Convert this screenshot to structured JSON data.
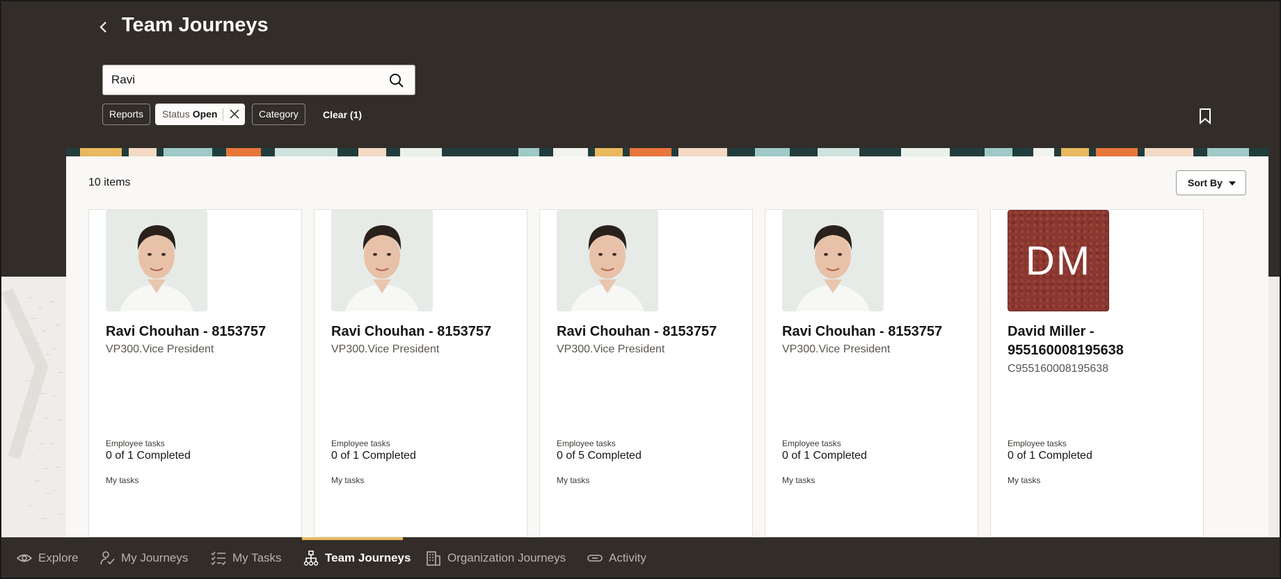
{
  "header": {
    "title": "Team Journeys",
    "back_icon": "chevron-left-icon"
  },
  "search": {
    "value": "Ravi",
    "icon": "search-icon"
  },
  "filters": {
    "reports_label": "Reports",
    "status_label": "Status",
    "status_value": "Open",
    "category_label": "Category",
    "clear_label": "Clear (1)"
  },
  "list": {
    "count_label": "10 items",
    "sort_label": "Sort By",
    "cards": [
      {
        "name": "Ravi Chouhan - 8153757",
        "subtitle": "VP300.Vice President",
        "tasks_label": "Employee tasks",
        "tasks_value": "0 of 1 Completed",
        "my_tasks_label": "My tasks"
      },
      {
        "name": "Ravi Chouhan - 8153757",
        "subtitle": "VP300.Vice President",
        "tasks_label": "Employee tasks",
        "tasks_value": "0 of 1 Completed",
        "my_tasks_label": "My tasks"
      },
      {
        "name": "Ravi Chouhan - 8153757",
        "subtitle": "VP300.Vice President",
        "tasks_label": "Employee tasks",
        "tasks_value": "0 of 5 Completed",
        "my_tasks_label": "My tasks"
      },
      {
        "name": "Ravi Chouhan - 8153757",
        "subtitle": "VP300.Vice President",
        "tasks_label": "Employee tasks",
        "tasks_value": "0 of 1 Completed",
        "my_tasks_label": "My tasks"
      },
      {
        "name": "David Miller - 955160008195638",
        "initials": "DM",
        "subtitle": "C955160008195638",
        "tasks_label": "Employee tasks",
        "tasks_value": "0 of 1 Completed",
        "my_tasks_label": "My tasks"
      }
    ]
  },
  "nav": {
    "items": [
      {
        "label": "Explore",
        "icon": "eye-icon"
      },
      {
        "label": "My Journeys",
        "icon": "person-check-icon"
      },
      {
        "label": "My Tasks",
        "icon": "checklist-icon"
      },
      {
        "label": "Team Journeys",
        "icon": "org-chart-icon",
        "active": true
      },
      {
        "label": "Organization Journeys",
        "icon": "building-icon"
      },
      {
        "label": "Activity",
        "icon": "link-icon"
      }
    ]
  },
  "colors": {
    "header_bg": "#322d28",
    "active_tab_accent": "#e9b85e",
    "initials_avatar_bg": "#8a3730"
  }
}
